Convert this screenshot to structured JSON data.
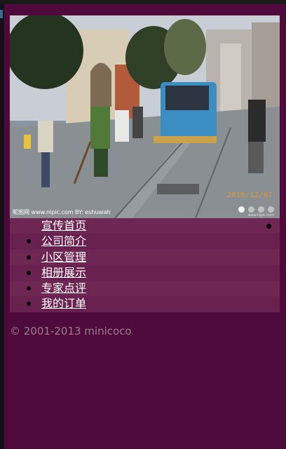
{
  "banner": {
    "image_alt": "Street scene with sweeper truck",
    "watermark_left": "昵图网 www.nipic.com BY: eshuaiah",
    "date_stamp": "2010/12/07",
    "watermark_right": "www.nipic.com",
    "slide_count": 4,
    "active_slide": 1
  },
  "nav": {
    "items": [
      {
        "label": "宣传首页"
      },
      {
        "label": "公司简介"
      },
      {
        "label": "小区管理"
      },
      {
        "label": "相册展示"
      },
      {
        "label": "专家点评"
      },
      {
        "label": "我的订单"
      }
    ]
  },
  "footer": {
    "copyright": "© 2001-2013 minicoco"
  },
  "colors": {
    "background": "#4f0a3c",
    "menu_bg": "#6b2450",
    "footer_text": "#a07a90",
    "date_stamp": "#e39a2b"
  }
}
